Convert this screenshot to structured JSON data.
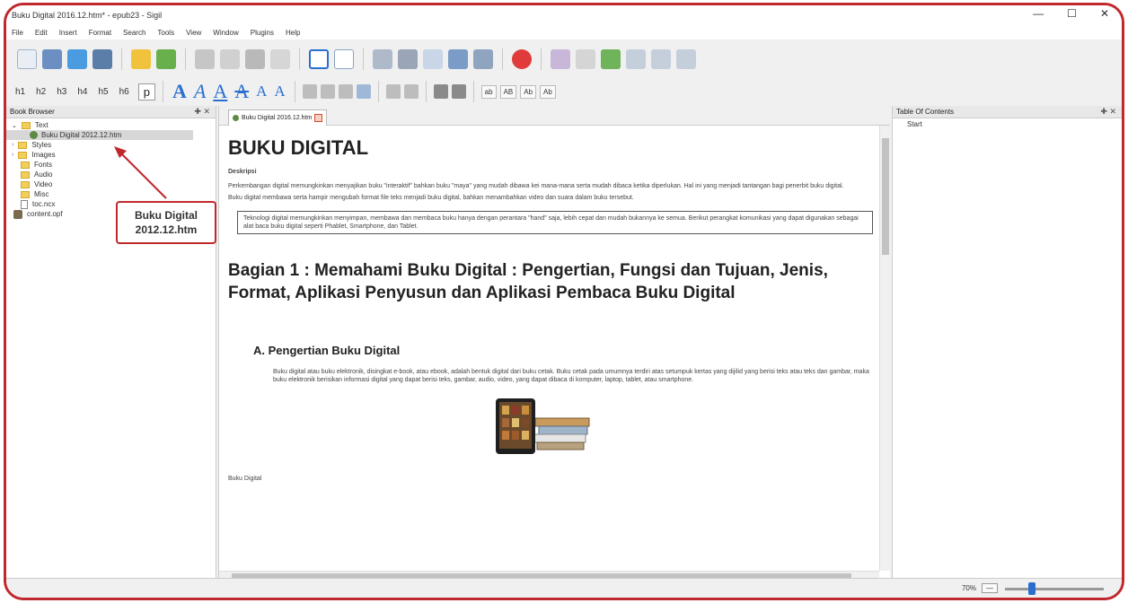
{
  "window": {
    "title": "Buku Digital 2016.12.htm* - epub23 - Sigil",
    "minimize": "—",
    "maximize": "☐",
    "close": "✕"
  },
  "menu": [
    "File",
    "Edit",
    "Insert",
    "Format",
    "Search",
    "Tools",
    "View",
    "Window",
    "Plugins",
    "Help"
  ],
  "toolbar2": {
    "headings": [
      "h1",
      "h2",
      "h3",
      "h4",
      "h5",
      "h6"
    ],
    "paragraph": "p",
    "case_buttons": [
      "ab",
      "AB",
      "Ab",
      "Ab"
    ]
  },
  "book_browser": {
    "title": "Book Browser",
    "pin": "✚ ✕",
    "items": [
      {
        "label": "Text",
        "kind": "folder"
      },
      {
        "label": "Buku Digital 2012.12.htm",
        "kind": "file"
      },
      {
        "label": "Styles",
        "kind": "folder"
      },
      {
        "label": "Images",
        "kind": "folder"
      },
      {
        "label": "Fonts",
        "kind": "folder"
      },
      {
        "label": "Audio",
        "kind": "folder"
      },
      {
        "label": "Video",
        "kind": "folder"
      },
      {
        "label": "Misc",
        "kind": "folder"
      },
      {
        "label": "toc.ncx",
        "kind": "file"
      },
      {
        "label": "content.opf",
        "kind": "file"
      }
    ]
  },
  "callout": {
    "line1": "Buku Digital",
    "line2": "2012.12.htm"
  },
  "editor": {
    "tab_label": "Buku Digital 2016.12.htm",
    "heading1": "BUKU DIGITAL",
    "deskripsi_label": "Deskripsi",
    "para1": "Perkembangan digital memungkinkan menyajikan buku \"interaktif\" bahkan buku \"maya\" yang mudah dibawa kei mana-mana serta mudah dibaca ketika diperlukan. Hal ini yang menjadi tantangan bagi penerbit buku digital.",
    "para2": "Buku digital membawa serta hampir mengubah format file teks menjadi buku digital, bahkan menambahkan video dan suara dalam buku tersebut.",
    "boxed": "Teknologi digital memungkinkan menyimpan, membawa dan membaca buku hanya dengan perantara \"hand\" saja, lebih cepat dan mudah bukannya ke semua. Berikut perangkat komunikasi yang dapat digunakan sebagai alat baca buku digital seperti Phablet, Smartphone, dan Tablet.",
    "heading2": "Bagian 1 : Memahami Buku Digital : Pengertian, Fungsi dan Tujuan, Jenis, Format, Aplikasi Penyusun dan Aplikasi Pembaca Buku Digital",
    "heading3": "A. Pengertian Buku Digital",
    "para3": "Buku digital atau buku elektronik, disingkat e-book, atau ebook, adalah bentuk digital dari buku cetak. Buku cetak pada umumnya terdiri atas setumpuk kertas yang dijilid yang berisi teks atau teks dan gambar, maka buku elektronik berisikan informasi digital yang dapat berisi teks, gambar, audio, video, yang dapat dibaca di komputer, laptop, tablet, atau smartphone.",
    "image_caption": "Buku Digital"
  },
  "toc": {
    "title": "Table Of Contents",
    "pin": "✚ ✕",
    "items": [
      "Start"
    ]
  },
  "status": {
    "zoom": "70%",
    "zoom_minus": "—"
  },
  "colors": {
    "accent": "#c0282d",
    "font_a": "#2a6fd0"
  }
}
